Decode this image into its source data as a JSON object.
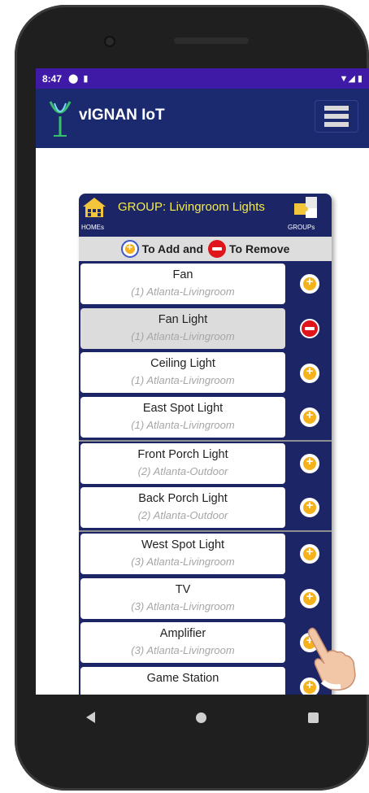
{
  "status_bar": {
    "time": "8:47"
  },
  "app": {
    "title": "vIGNAN IoT"
  },
  "group_panel": {
    "title": "GROUP: Livingroom Lights",
    "homes_label": "HOMEs",
    "groups_label": "GROUPs",
    "instruction_add": "To Add and",
    "instruction_remove": "To Remove"
  },
  "devices": [
    {
      "name": "Fan",
      "location": "(1) Atlanta-Livingroom",
      "action": "add"
    },
    {
      "name": "Fan Light",
      "location": "(1) Atlanta-Livingroom",
      "action": "remove",
      "selected": true
    },
    {
      "name": "Ceiling Light",
      "location": "(1) Atlanta-Livingroom",
      "action": "add"
    },
    {
      "name": "East Spot Light",
      "location": "(1) Atlanta-Livingroom",
      "action": "add"
    },
    {
      "name": "Front Porch Light",
      "location": "(2) Atlanta-Outdoor",
      "action": "add"
    },
    {
      "name": "Back Porch Light",
      "location": "(2) Atlanta-Outdoor",
      "action": "add"
    },
    {
      "name": "West Spot Light",
      "location": "(3) Atlanta-Livingroom",
      "action": "add"
    },
    {
      "name": "TV",
      "location": "(3) Atlanta-Livingroom",
      "action": "add"
    },
    {
      "name": "Amplifier",
      "location": "(3) Atlanta-Livingroom",
      "action": "add"
    },
    {
      "name": "Game Station",
      "location": "",
      "action": "add"
    }
  ],
  "colors": {
    "status_bar": "#3f1aa6",
    "app_bar": "#1b2a6e",
    "panel": "#1c2566",
    "group_title": "#f4ec4a",
    "add_button": "#f6b21b",
    "remove_button": "#e0151c"
  }
}
